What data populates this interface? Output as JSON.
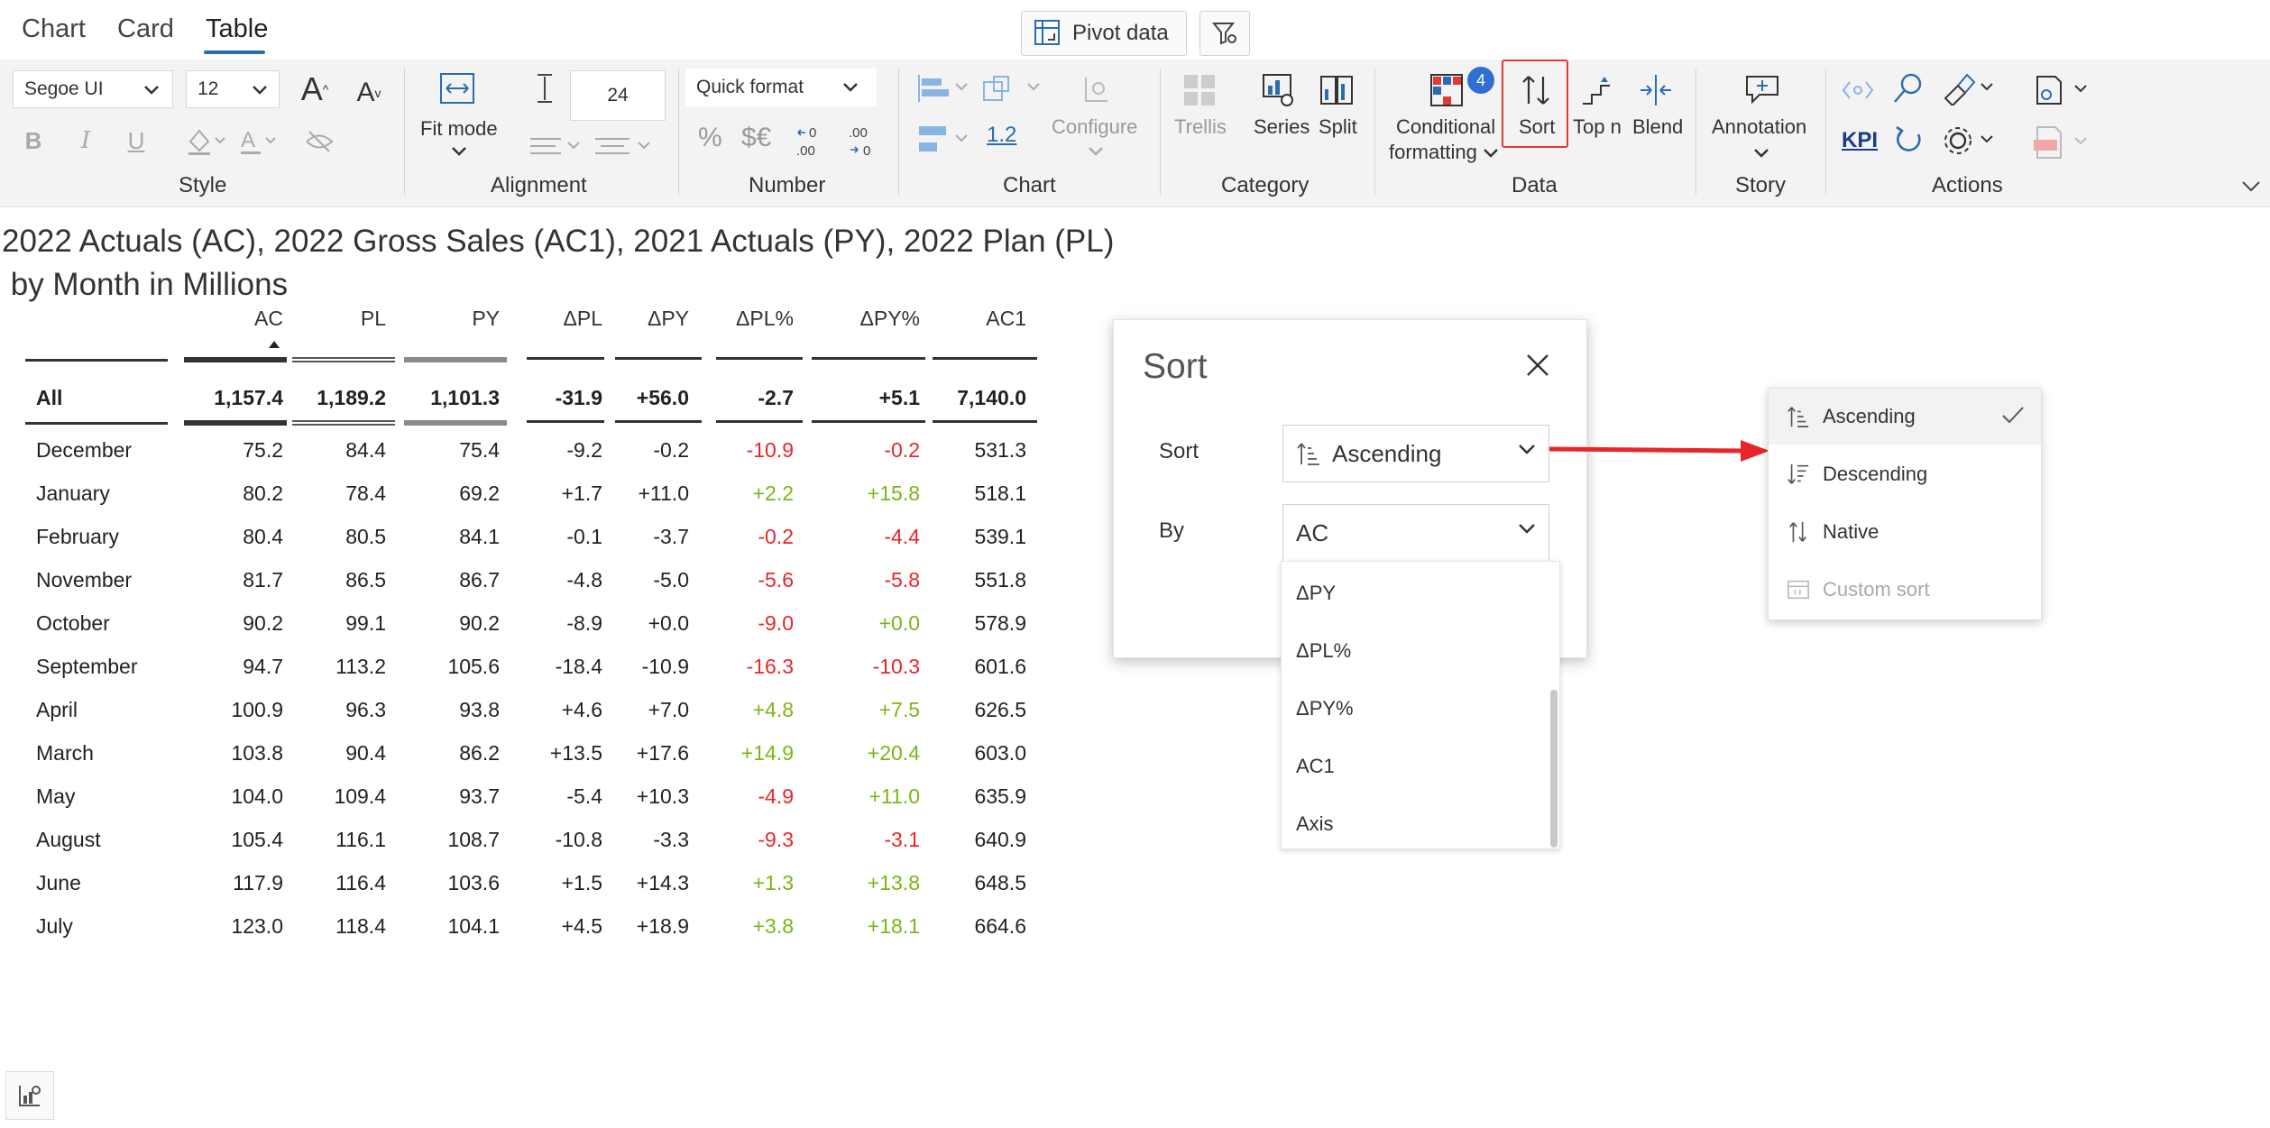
{
  "tabs": [
    {
      "label": "Chart"
    },
    {
      "label": "Card"
    },
    {
      "label": "Table"
    }
  ],
  "toolbar_top": {
    "pivot_label": "Pivot data"
  },
  "ribbon": {
    "style": {
      "label": "Style",
      "font_family": "Segoe UI",
      "font_size": "12"
    },
    "alignment": {
      "label": "Alignment",
      "fit_mode": "Fit mode",
      "row_height": "24"
    },
    "number": {
      "label": "Number",
      "quick_format": "Quick format",
      "percent": "%",
      "currency": "$€",
      "dec_less": ".00",
      "dec_more": ".00"
    },
    "chart": {
      "label": "Chart",
      "scale_value": "1.2",
      "configure": "Configure"
    },
    "category": {
      "label": "Category",
      "trellis": "Trellis",
      "series": "Series",
      "split": "Split"
    },
    "data": {
      "label": "Data",
      "conditional": "Conditional",
      "formatting": "formatting",
      "badge": "4",
      "sort": "Sort",
      "top_n": "Top n",
      "blend": "Blend"
    },
    "story": {
      "label": "Story",
      "annotation": "Annotation"
    },
    "actions": {
      "label": "Actions",
      "kpi": "KPI"
    }
  },
  "title": {
    "line1": "2022 Actuals (AC), 2022 Gross Sales (AC1), 2021 Actuals (PY), 2022 Plan (PL)",
    "line2": " by Month in Millions"
  },
  "table": {
    "columns": [
      "AC",
      "PL",
      "PY",
      "ΔPL",
      "ΔPY",
      "ΔPL%",
      "ΔPY%",
      "AC1"
    ],
    "total": {
      "label": "All",
      "values": [
        "1,157.4",
        "1,189.2",
        "1,101.3",
        "-31.9",
        "+56.0",
        "-2.7",
        "+5.1",
        "7,140.0"
      ]
    },
    "rows": [
      {
        "label": "December",
        "values": [
          "75.2",
          "84.4",
          "75.4",
          "-9.2",
          "-0.2",
          "-10.9",
          "-0.2",
          "531.3"
        ]
      },
      {
        "label": "January",
        "values": [
          "80.2",
          "78.4",
          "69.2",
          "+1.7",
          "+11.0",
          "+2.2",
          "+15.8",
          "518.1"
        ]
      },
      {
        "label": "February",
        "values": [
          "80.4",
          "80.5",
          "84.1",
          "-0.1",
          "-3.7",
          "-0.2",
          "-4.4",
          "539.1"
        ]
      },
      {
        "label": "November",
        "values": [
          "81.7",
          "86.5",
          "86.7",
          "-4.8",
          "-5.0",
          "-5.6",
          "-5.8",
          "551.8"
        ]
      },
      {
        "label": "October",
        "values": [
          "90.2",
          "99.1",
          "90.2",
          "-8.9",
          "+0.0",
          "-9.0",
          "+0.0",
          "578.9"
        ]
      },
      {
        "label": "September",
        "values": [
          "94.7",
          "113.2",
          "105.6",
          "-18.4",
          "-10.9",
          "-16.3",
          "-10.3",
          "601.6"
        ]
      },
      {
        "label": "April",
        "values": [
          "100.9",
          "96.3",
          "93.8",
          "+4.6",
          "+7.0",
          "+4.8",
          "+7.5",
          "626.5"
        ]
      },
      {
        "label": "March",
        "values": [
          "103.8",
          "90.4",
          "86.2",
          "+13.5",
          "+17.6",
          "+14.9",
          "+20.4",
          "603.0"
        ]
      },
      {
        "label": "May",
        "values": [
          "104.0",
          "109.4",
          "93.7",
          "-5.4",
          "+10.3",
          "-4.9",
          "+11.0",
          "635.9"
        ]
      },
      {
        "label": "August",
        "values": [
          "105.4",
          "116.1",
          "108.7",
          "-10.8",
          "-3.3",
          "-9.3",
          "-3.1",
          "640.9"
        ]
      },
      {
        "label": "June",
        "values": [
          "117.9",
          "116.4",
          "103.6",
          "+1.5",
          "+14.3",
          "+1.3",
          "+13.8",
          "648.5"
        ]
      },
      {
        "label": "July",
        "values": [
          "123.0",
          "118.4",
          "104.1",
          "+4.5",
          "+18.9",
          "+3.8",
          "+18.1",
          "664.6"
        ]
      }
    ]
  },
  "sort_dialog": {
    "title": "Sort",
    "sort_label": "Sort",
    "sort_value": "Ascending",
    "by_label": "By",
    "by_value": "AC",
    "by_options": [
      "ΔPY",
      "ΔPL%",
      "ΔPY%",
      "AC1",
      "Axis"
    ]
  },
  "sort_menu": {
    "items": [
      {
        "label": "Ascending",
        "selected": true
      },
      {
        "label": "Descending"
      },
      {
        "label": "Native"
      },
      {
        "label": "Custom sort",
        "disabled": true
      }
    ]
  },
  "colors": {
    "accent": "#2b6cb0",
    "negative": "#e8262a",
    "positive": "#7cb518",
    "highlight_border": "#e53935",
    "badge": "#2f6fd1"
  }
}
